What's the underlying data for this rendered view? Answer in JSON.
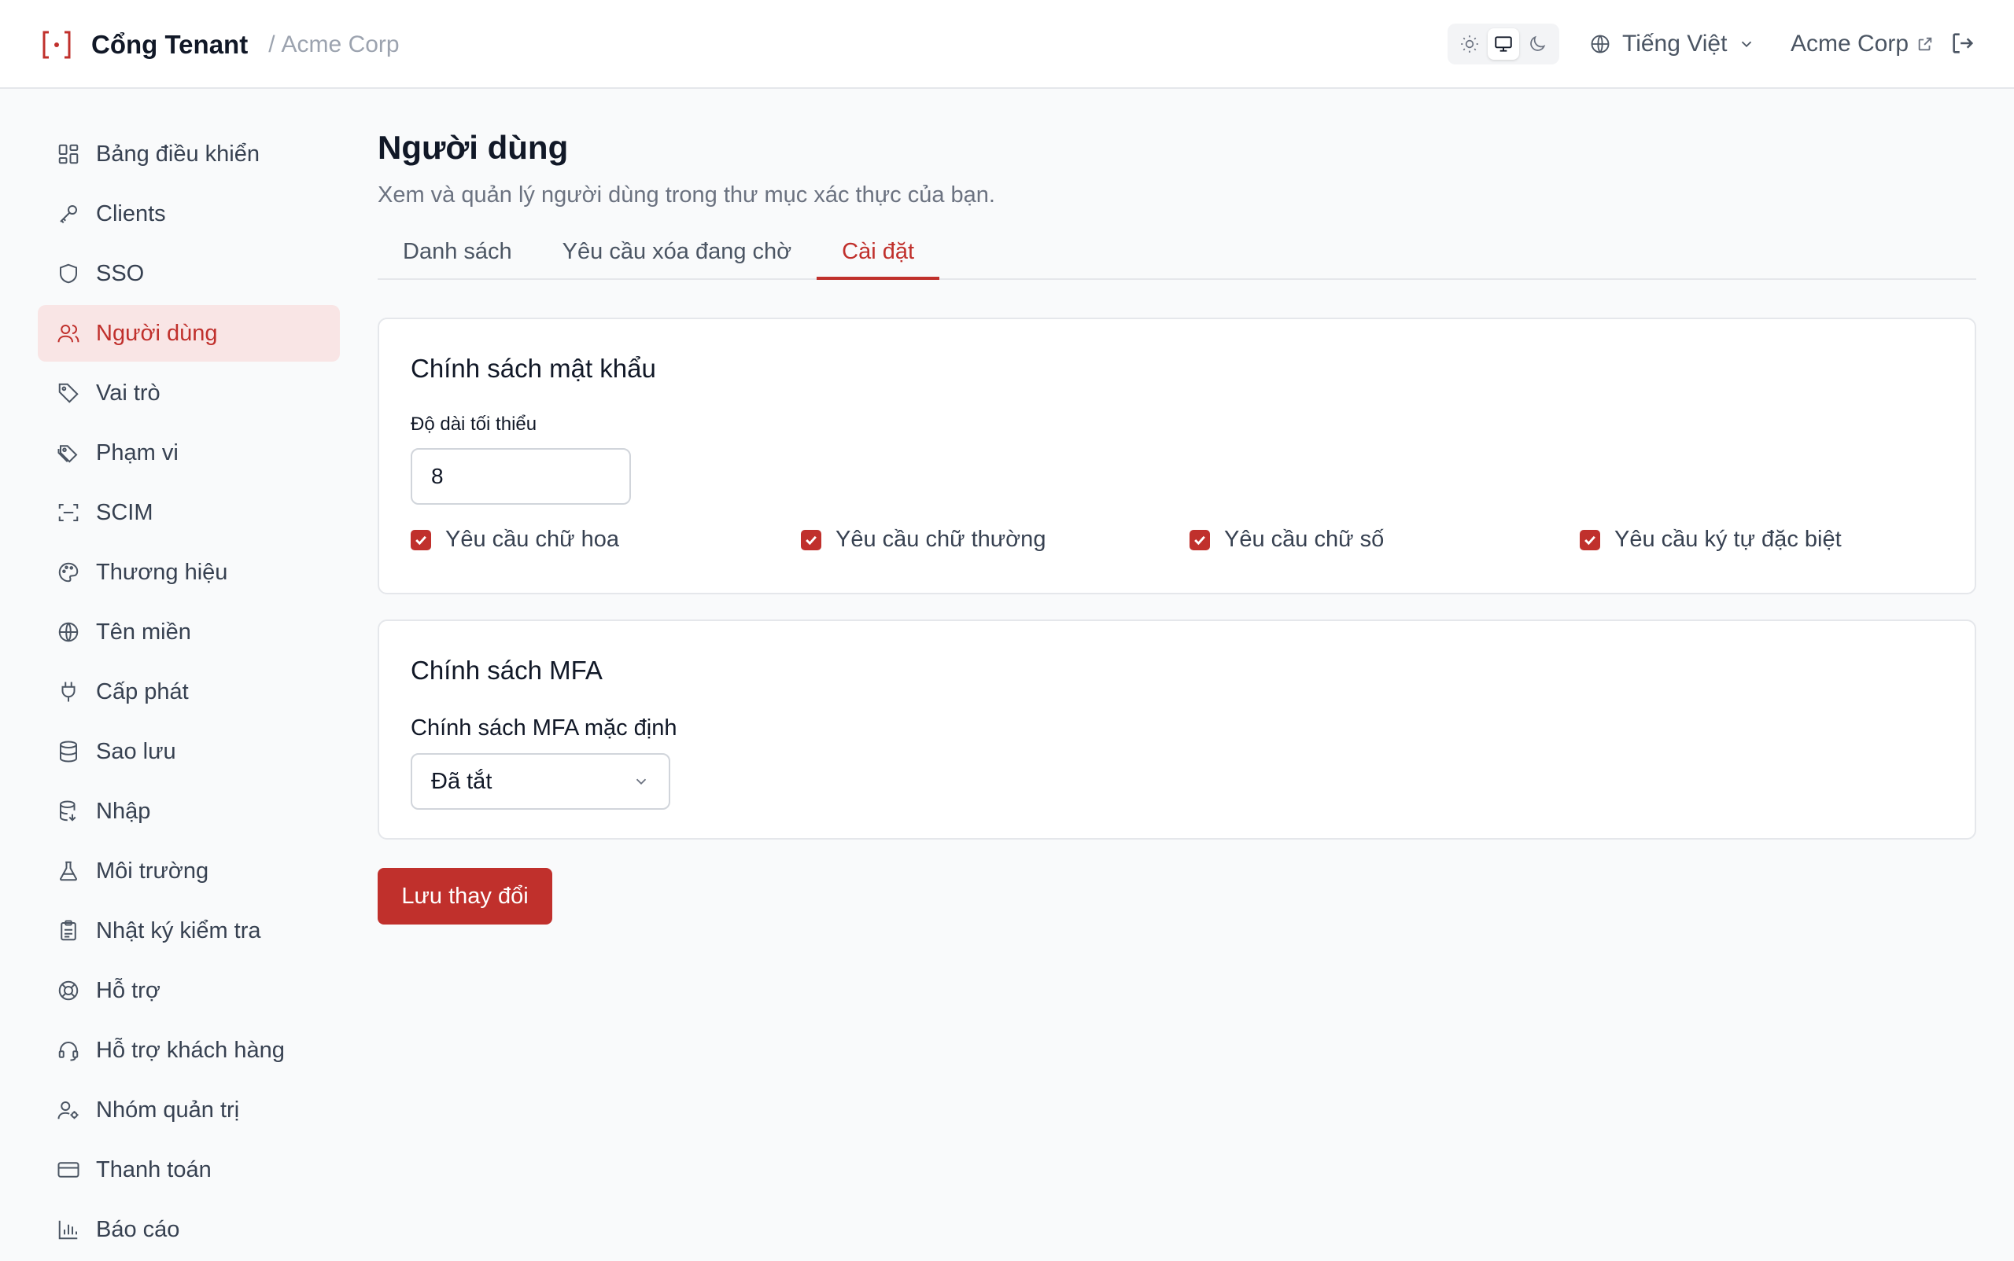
{
  "header": {
    "brand_name": "Cổng Tenant",
    "separator": "/",
    "org_name": "Acme Corp",
    "language": "Tiếng Việt",
    "org_link": "Acme Corp",
    "accent": "#c0302c"
  },
  "theme": {
    "options": [
      "sun-icon",
      "monitor-icon",
      "moon-icon"
    ],
    "selected": "monitor-icon"
  },
  "sidebar": {
    "items": [
      {
        "label": "Bảng điều khiển",
        "icon": "dashboard-icon"
      },
      {
        "label": "Clients",
        "icon": "key-icon"
      },
      {
        "label": "SSO",
        "icon": "shield-icon"
      },
      {
        "label": "Người dùng",
        "icon": "users-icon",
        "active": true
      },
      {
        "label": "Vai trò",
        "icon": "tag-icon"
      },
      {
        "label": "Phạm vi",
        "icon": "tags-icon"
      },
      {
        "label": "SCIM",
        "icon": "scan-icon"
      },
      {
        "label": "Thương hiệu",
        "icon": "palette-icon"
      },
      {
        "label": "Tên miền",
        "icon": "globe-icon"
      },
      {
        "label": "Cấp phát",
        "icon": "plug-icon"
      },
      {
        "label": "Sao lưu",
        "icon": "database-icon"
      },
      {
        "label": "Nhập",
        "icon": "database-import-icon"
      },
      {
        "label": "Môi trường",
        "icon": "flask-icon"
      },
      {
        "label": "Nhật ký kiểm tra",
        "icon": "clipboard-icon"
      },
      {
        "label": "Hỗ trợ",
        "icon": "lifebuoy-icon"
      },
      {
        "label": "Hỗ trợ khách hàng",
        "icon": "headset-icon"
      },
      {
        "label": "Nhóm quản trị",
        "icon": "user-cog-icon"
      },
      {
        "label": "Thanh toán",
        "icon": "credit-card-icon"
      },
      {
        "label": "Báo cáo",
        "icon": "bar-chart-icon"
      }
    ]
  },
  "main": {
    "title": "Người dùng",
    "subtitle": "Xem và quản lý người dùng trong thư mục xác thực của bạn.",
    "tabs": [
      {
        "label": "Danh sách"
      },
      {
        "label": "Yêu cầu xóa đang chờ"
      },
      {
        "label": "Cài đặt",
        "active": true
      }
    ],
    "password_policy": {
      "title": "Chính sách mật khẩu",
      "min_length_label": "Độ dài tối thiểu",
      "min_length_value": "8",
      "options": [
        {
          "label": "Yêu cầu chữ hoa",
          "checked": true
        },
        {
          "label": "Yêu cầu chữ thường",
          "checked": true
        },
        {
          "label": "Yêu cầu chữ số",
          "checked": true
        },
        {
          "label": "Yêu cầu ký tự đặc biệt",
          "checked": true
        }
      ]
    },
    "mfa_policy": {
      "title": "Chính sách MFA",
      "default_label": "Chính sách MFA mặc định",
      "default_value": "Đã tắt"
    },
    "save_label": "Lưu thay đổi"
  }
}
